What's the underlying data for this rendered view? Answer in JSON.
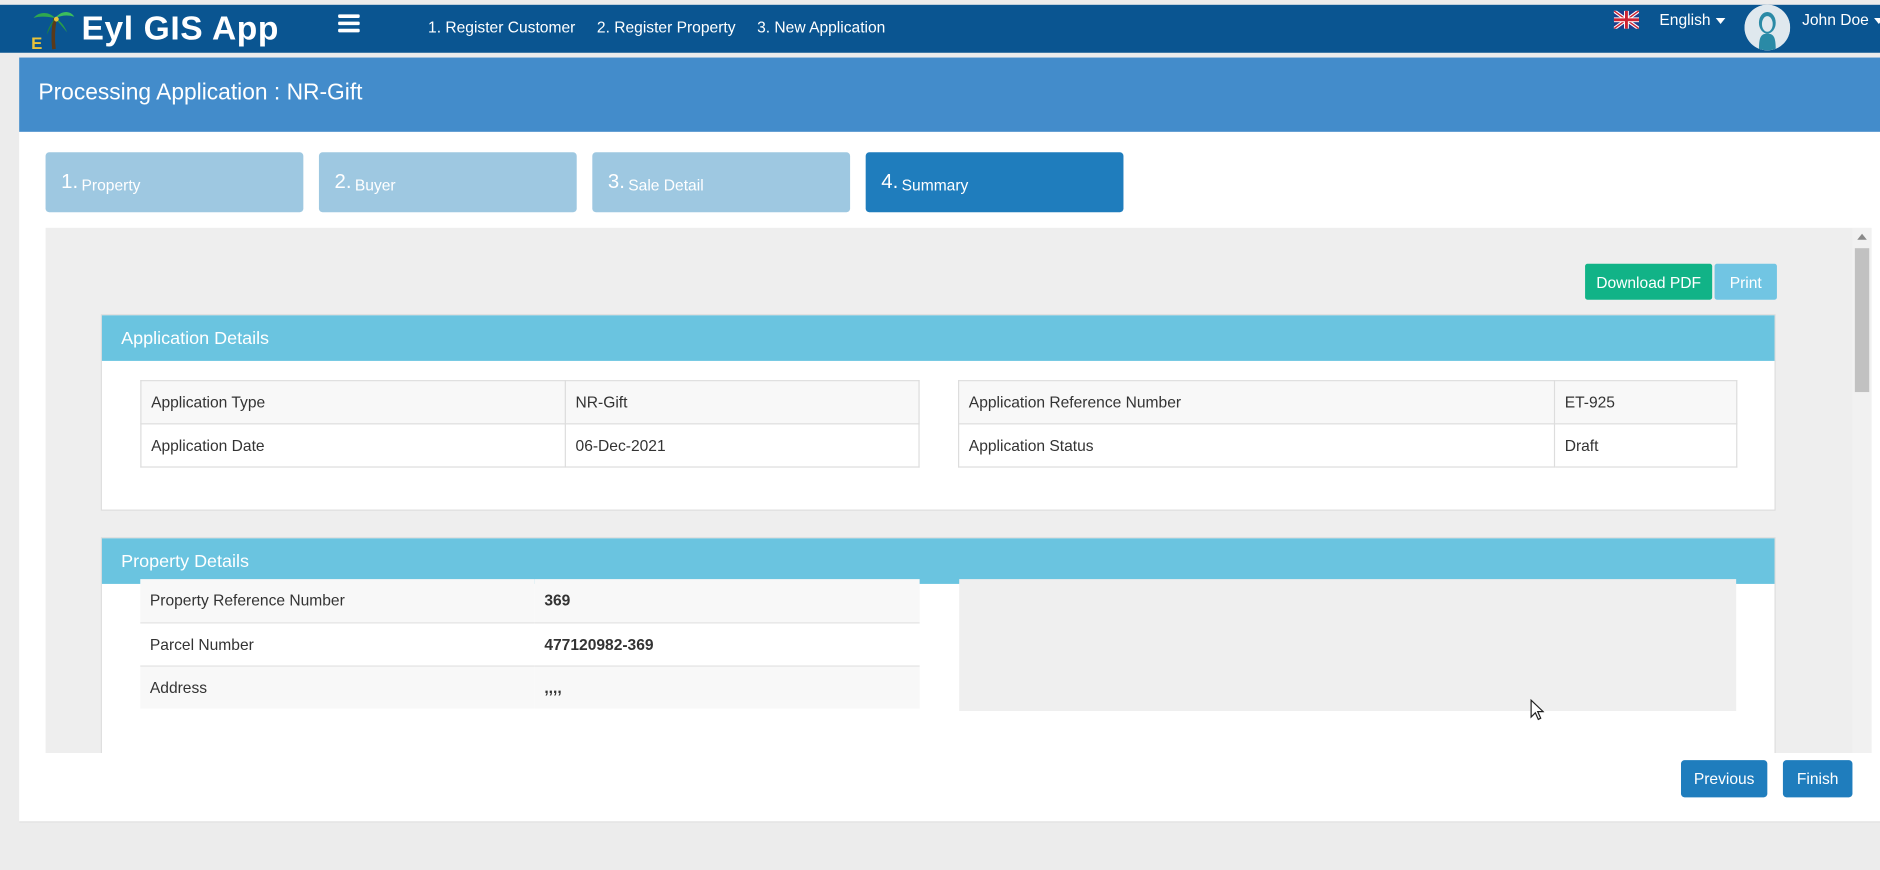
{
  "app": {
    "title": "Eyl GIS App"
  },
  "topnav": {
    "items": [
      "1. Register Customer",
      "2. Register Property",
      "3. New Application"
    ]
  },
  "header": {
    "language": "English",
    "user": "John Doe"
  },
  "page": {
    "title": "Processing Application : NR-Gift"
  },
  "steps": [
    {
      "num": "1.",
      "label": "Property"
    },
    {
      "num": "2.",
      "label": "Buyer"
    },
    {
      "num": "3.",
      "label": "Sale Detail"
    },
    {
      "num": "4.",
      "label": "Summary"
    }
  ],
  "actions": {
    "download_pdf": "Download PDF",
    "print": "Print",
    "previous": "Previous",
    "finish": "Finish"
  },
  "application_details": {
    "title": "Application Details",
    "left": [
      {
        "label": "Application Type",
        "value": "NR-Gift"
      },
      {
        "label": "Application Date",
        "value": "06-Dec-2021"
      }
    ],
    "right": [
      {
        "label": "Application Reference Number",
        "value": "ET-925"
      },
      {
        "label": "Application Status",
        "value": "Draft"
      }
    ]
  },
  "property_details": {
    "title": "Property Details",
    "rows": [
      {
        "label": "Property Reference Number",
        "value": "369"
      },
      {
        "label": "Parcel Number",
        "value": "477120982-369"
      },
      {
        "label": "Address",
        "value": ",,,,"
      }
    ]
  },
  "colors": {
    "navbar": "#0a5591",
    "header": "#438ccb",
    "step_active": "#1f7dbd",
    "step_inactive": "#9ec8e1",
    "section_head": "#6ac4e0",
    "pdf_button": "#11b387"
  }
}
